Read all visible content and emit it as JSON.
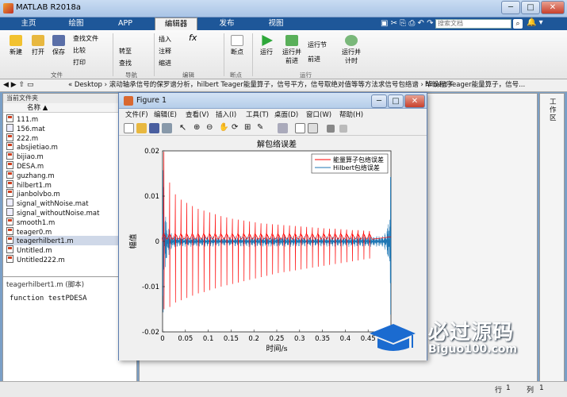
{
  "window": {
    "title": "MATLAB R2018a",
    "minimize": "─",
    "maximize": "□",
    "close": "✕"
  },
  "tabs": [
    {
      "label": "主页"
    },
    {
      "label": "绘图"
    },
    {
      "label": "APP"
    },
    {
      "label": "编辑器"
    },
    {
      "label": "发布"
    },
    {
      "label": "视图"
    }
  ],
  "search": {
    "placeholder": "搜索文档"
  },
  "toolstrip": {
    "file": {
      "new": "新建",
      "open": "打开",
      "save": "保存",
      "find_files": "查找文件",
      "compare": "比较",
      "print": "打印",
      "section": "文件"
    },
    "nav": {
      "goto": "转至",
      "find": "查找",
      "section": "导航"
    },
    "edit": {
      "insert": "插入",
      "fx": "fx",
      "comment": "注释",
      "indent": "缩进",
      "section": "编辑"
    },
    "breakpoints": {
      "label": "断点",
      "section": "断点"
    },
    "run": {
      "run": "运行",
      "run_advance": "运行并\n前进",
      "run_section": "运行节",
      "advance": "前进",
      "run_time": "运行并\n计时",
      "section": "运行"
    }
  },
  "address": {
    "path": "« Desktop › 滚动轴承信号的保罗谱分析，hilbert Teager能量算子，信号平方，信号取绝对值等等方法求信号包络谱 › 毕设程序",
    "right": "hilbert Teager能量算子，信号..."
  },
  "current_folder": {
    "header": "当前文件夹",
    "col_name": "名称 ▲"
  },
  "files": [
    {
      "name": "111.m",
      "type": "m"
    },
    {
      "name": "156.mat",
      "type": "mat"
    },
    {
      "name": "222.m",
      "type": "m"
    },
    {
      "name": "absjietiao.m",
      "type": "m"
    },
    {
      "name": "bijiao.m",
      "type": "m"
    },
    {
      "name": "DESA.m",
      "type": "m"
    },
    {
      "name": "guzhang.m",
      "type": "m"
    },
    {
      "name": "hilbert1.m",
      "type": "m"
    },
    {
      "name": "jianbolvbo.m",
      "type": "m"
    },
    {
      "name": "signal_withNoise.mat",
      "type": "mat"
    },
    {
      "name": "signal_withoutNoise.mat",
      "type": "mat"
    },
    {
      "name": "smooth1.m",
      "type": "m"
    },
    {
      "name": "teager0.m",
      "type": "m"
    },
    {
      "name": "teagerhilbert1.m",
      "type": "m",
      "selected": true
    },
    {
      "name": "Untitled.m",
      "type": "m"
    },
    {
      "name": "Untitled222.m",
      "type": "m"
    }
  ],
  "detail": {
    "title": "teagerhilbert1.m  (脚本)",
    "code": "function testPDESA"
  },
  "right_panel": {
    "label": "工作区"
  },
  "status": {
    "row_label": "行",
    "row": "1",
    "col_label": "列",
    "col": "1"
  },
  "figure": {
    "title": "Figure 1",
    "menu": [
      "文件(F)",
      "编辑(E)",
      "查看(V)",
      "插入(I)",
      "工具(T)",
      "桌面(D)",
      "窗口(W)",
      "帮助(H)"
    ]
  },
  "logo": {
    "text": "必过源码",
    "url": "Biguo100.com"
  },
  "colors": {
    "series1": "#ff0000",
    "series2": "#1f77b4",
    "tab_bar": "#1e5799"
  },
  "chart_data": {
    "type": "line",
    "title": "解包络误差",
    "xlabel": "时间/s",
    "ylabel": "幅值",
    "xlim": [
      0,
      0.5
    ],
    "ylim": [
      -0.02,
      0.02
    ],
    "xticks": [
      0,
      0.05,
      0.1,
      0.15,
      0.2,
      0.25,
      0.3,
      0.35,
      0.4,
      0.45,
      0.5
    ],
    "yticks": [
      -0.02,
      -0.01,
      0,
      0.01,
      0.02
    ],
    "xtick_labels": [
      "0",
      "0.05",
      "0.1",
      "0.15",
      "0.2",
      "0.25",
      "0.3",
      "0.35",
      "0.4",
      "0.45",
      "0.5"
    ],
    "ytick_labels": [
      "-0.02",
      "-0.01",
      "0",
      "0.01",
      "0.02"
    ],
    "legend": "top-right",
    "series": [
      {
        "name": "能量算子包络误差",
        "color": "#ff0000",
        "pulse_period": 0.0125,
        "positive_peaks": [
          0.0198,
          0.013,
          0.0104,
          0.0092,
          0.0085,
          0.0078,
          0.0072,
          0.0068,
          0.0064,
          0.006,
          0.0056,
          0.0053,
          0.005,
          0.0048,
          0.0046,
          0.0044,
          0.0042,
          0.004,
          0.0039,
          0.0038,
          0.0037,
          0.0036,
          0.0035,
          0.0034,
          0.0033,
          0.0032,
          0.0031,
          0.003,
          0.0029,
          0.0028,
          0.0028,
          0.0027,
          0.0026,
          0.0025,
          0.0025,
          0.0024,
          0.0023
        ],
        "negative_peaks": [
          -0.015,
          -0.0145,
          -0.0135,
          -0.013,
          -0.0125,
          -0.012,
          -0.0115,
          -0.0112,
          -0.0108,
          -0.0104,
          -0.01,
          -0.0097,
          -0.0094,
          -0.0091,
          -0.0088,
          -0.0085,
          -0.0082,
          -0.0079,
          -0.0076,
          -0.0073,
          -0.007,
          -0.0068,
          -0.0066,
          -0.0064,
          -0.0062,
          -0.006,
          -0.0058,
          -0.0056,
          -0.0054,
          -0.0052,
          -0.005,
          -0.0048,
          -0.0046,
          -0.0044,
          -0.0042,
          -0.004,
          -0.0038
        ]
      },
      {
        "name": "Hilbert包络误差",
        "color": "#1f77b4",
        "edge_amplitude": 0.02,
        "mid_amplitude": 0.0012
      }
    ]
  }
}
